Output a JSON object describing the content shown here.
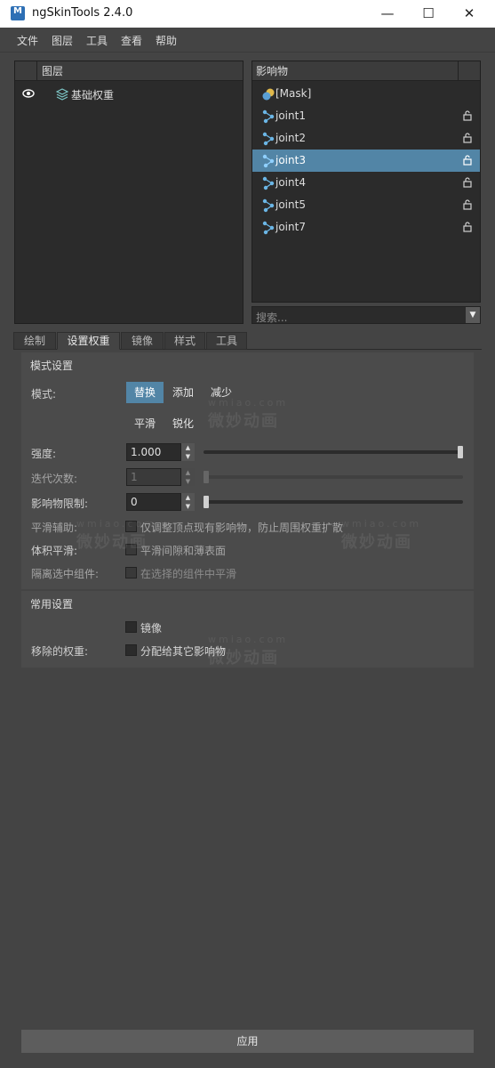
{
  "window": {
    "title": "ngSkinTools 2.4.0",
    "icon_text": "M"
  },
  "menu": [
    "文件",
    "图层",
    "工具",
    "查看",
    "帮助"
  ],
  "layers_panel": {
    "header": "图层",
    "items": [
      {
        "label": "基础权重",
        "visible": true
      }
    ]
  },
  "influences_panel": {
    "header": "影响物",
    "items": [
      {
        "label": "[Mask]",
        "type": "mask"
      },
      {
        "label": "joint1",
        "type": "joint"
      },
      {
        "label": "joint2",
        "type": "joint"
      },
      {
        "label": "joint3",
        "type": "joint",
        "selected": true
      },
      {
        "label": "joint4",
        "type": "joint"
      },
      {
        "label": "joint5",
        "type": "joint"
      },
      {
        "label": "joint7",
        "type": "joint"
      }
    ],
    "search_placeholder": "搜索..."
  },
  "tabs": [
    {
      "label": "绘制"
    },
    {
      "label": "设置权重",
      "active": true
    },
    {
      "label": "镜像"
    },
    {
      "label": "样式"
    },
    {
      "label": "工具"
    }
  ],
  "mode_settings": {
    "title": "模式设置",
    "mode_label": "模式:",
    "modes": [
      "替换",
      "添加",
      "减少"
    ],
    "selected_mode": "替换",
    "mode2": [
      "平滑",
      "锐化"
    ],
    "intensity_label": "强度:",
    "intensity_value": "1.000",
    "intensity_level": 1.0,
    "iterations_label": "迭代次数:",
    "iterations_value": "1",
    "influence_limit_label": "影响物限制:",
    "influence_limit_value": "0",
    "smooth_assist_label": "平滑辅助:",
    "smooth_assist_option": "仅调整顶点现有影响物，防止周围权重扩散",
    "volume_smooth_label": "体积平滑:",
    "volume_smooth_option": "平滑间隙和薄表面",
    "isolate_label": "隔离选中组件:",
    "isolate_option": "在选择的组件中平滑"
  },
  "common_settings": {
    "title": "常用设置",
    "mirror_option": "镜像",
    "removed_weights_label": "移除的权重:",
    "removed_weights_option": "分配给其它影响物"
  },
  "watermark": {
    "brand": "微妙动画",
    "url": "wmiao.com"
  },
  "apply_label": "应用",
  "colors": {
    "selection": "#5285a6",
    "panel_bg": "#2b2b2b",
    "window_bg": "#444444"
  }
}
